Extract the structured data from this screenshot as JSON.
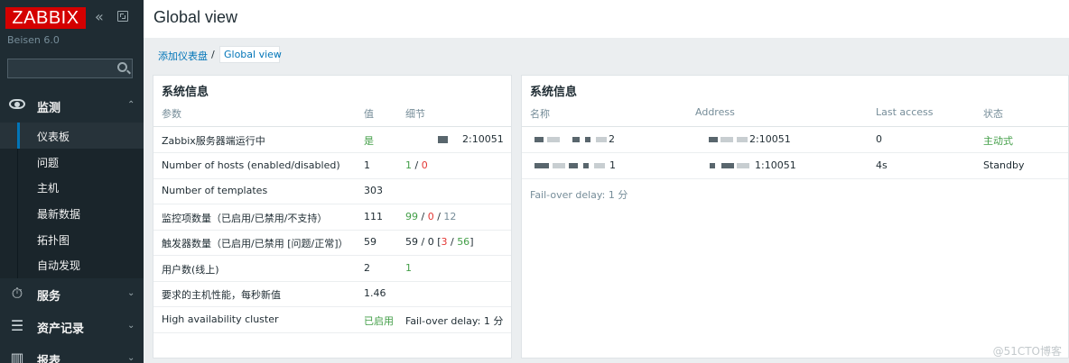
{
  "app": {
    "logo": "ZABBIX",
    "server_name": "Beisen 6.0",
    "search_placeholder": ""
  },
  "icons": {
    "collapse": "double-chevron-left-icon",
    "kiosk": "fullscreen-icon",
    "search": "search-icon",
    "monitoring": "eye-icon",
    "services": "stopwatch-icon",
    "inventory": "list-icon",
    "reports": "bar-chart-icon"
  },
  "colors": {
    "brand_red": "#d40000",
    "sidebar": "#1f2c33",
    "link": "#0275b8",
    "ok_green": "#429e47",
    "problem_red": "#e33734"
  },
  "sidebar": {
    "sections": [
      {
        "label": "监测",
        "expanded": true
      },
      {
        "label": "服务"
      },
      {
        "label": "资产记录"
      },
      {
        "label": "报表"
      }
    ],
    "monitoring_items": [
      {
        "label": "仪表板",
        "active": true
      },
      {
        "label": "问题"
      },
      {
        "label": "主机"
      },
      {
        "label": "最新数据"
      },
      {
        "label": "拓扑图"
      },
      {
        "label": "自动发现"
      }
    ]
  },
  "header": {
    "title": "Global view"
  },
  "breadcrumb": {
    "parent": "添加仪表盘",
    "separator": "/",
    "current": "Global view"
  },
  "widget_left": {
    "title": "系统信息",
    "columns": [
      "参数",
      "值",
      "细节"
    ],
    "rows": [
      {
        "param": "Zabbix服务器端运行中",
        "value": "是",
        "detail": "2:10051"
      },
      {
        "param": "Number of hosts (enabled/disabled)",
        "value": "1",
        "detail_a": "1",
        "detail_sep": " / ",
        "detail_b": "0"
      },
      {
        "param": "Number of templates",
        "value": "303"
      },
      {
        "param": "监控项数量（已启用/已禁用/不支持）",
        "value": "111",
        "detail_a": "99",
        "detail_sep1": " / ",
        "detail_b": "0",
        "detail_sep2": " / ",
        "detail_c": "12"
      },
      {
        "param": "触发器数量（已启用/已禁用 [问题/正常]）",
        "value": "59",
        "detail_prefix": "59 / 0 [",
        "detail_a": "3",
        "detail_sep": " / ",
        "detail_b": "56",
        "detail_suffix": "]"
      },
      {
        "param": "用户数(线上)",
        "value": "2",
        "detail": "1"
      },
      {
        "param": "要求的主机性能，每秒新值",
        "value": "1.46"
      },
      {
        "param": "High availability cluster",
        "value": "已启用",
        "detail": "Fail-over delay: 1 分"
      }
    ]
  },
  "widget_right": {
    "title": "系统信息",
    "columns": [
      "名称",
      "Address",
      "Last access",
      "状态"
    ],
    "rows": [
      {
        "name_suffix": "2",
        "address": "2:10051",
        "last_access": "0",
        "status": "主动式"
      },
      {
        "name_suffix": "1",
        "address": "1:10051",
        "last_access": "4s",
        "status": "Standby"
      }
    ],
    "footer": "Fail-over delay: 1 分"
  },
  "watermark": "@51CTO博客"
}
